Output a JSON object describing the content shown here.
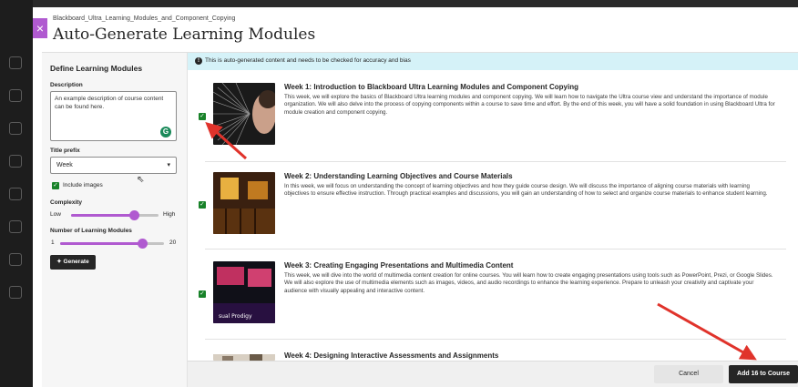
{
  "breadcrumb": "Blackboard_Ultra_Learning_Modules_and_Component_Copying",
  "title": "Auto-Generate Learning Modules",
  "close_icon": "×",
  "settings": {
    "heading": "Define Learning Modules",
    "description_label": "Description",
    "description_value": "An example description of course content can be found here.",
    "prefix_label": "Title prefix",
    "prefix_value": "Week",
    "include_images_label": "Include images",
    "include_images_checked": true,
    "complexity_label": "Complexity",
    "complexity_low": "Low",
    "complexity_high": "High",
    "complexity_level": 0.72,
    "count_label": "Number of Learning Modules",
    "count_min": "1",
    "count_max": "20",
    "count_value": 16,
    "generate_label": "Generate"
  },
  "notice": "This is auto-generated content and needs to be checked for accuracy and bias",
  "modules": [
    {
      "title": "Week 1: Introduction to Blackboard Ultra Learning Modules and Component Copying",
      "description": "This week, we will explore the basics of Blackboard Ultra learning modules and component copying. We will learn how to navigate the Ultra course view and understand the importance of module organization. We will also delve into the process of copying components within a course to save time and effort. By the end of this week, you will have a solid foundation in using Blackboard Ultra for module creation and component copying.",
      "checked": true
    },
    {
      "title": "Week 2: Understanding Learning Objectives and Course Materials",
      "description": "In this week, we will focus on understanding the concept of learning objectives and how they guide course design. We will discuss the importance of aligning course materials with learning objectives to ensure effective instruction. Through practical examples and discussions, you will gain an understanding of how to select and organize course materials to enhance student learning.",
      "checked": true
    },
    {
      "title": "Week 3: Creating Engaging Presentations and Multimedia Content",
      "description": "This week, we will dive into the world of multimedia content creation for online courses. You will learn how to create engaging presentations using tools such as PowerPoint, Prezi, or Google Slides. We will also explore the use of multimedia elements such as images, videos, and audio recordings to enhance the learning experience. Prepare to unleash your creativity and captivate your audience with visually appealing and interactive content.",
      "checked": true
    },
    {
      "title": "Week 4: Designing Interactive Assessments and Assignments",
      "description": "",
      "checked": true
    }
  ],
  "footer": {
    "cancel_label": "Cancel",
    "add_label": "Add 16 to Course"
  },
  "colors": {
    "accent": "#b05ad0",
    "check": "#188229",
    "notice_bg": "#d5f2f8",
    "arrow": "#e0332b"
  }
}
